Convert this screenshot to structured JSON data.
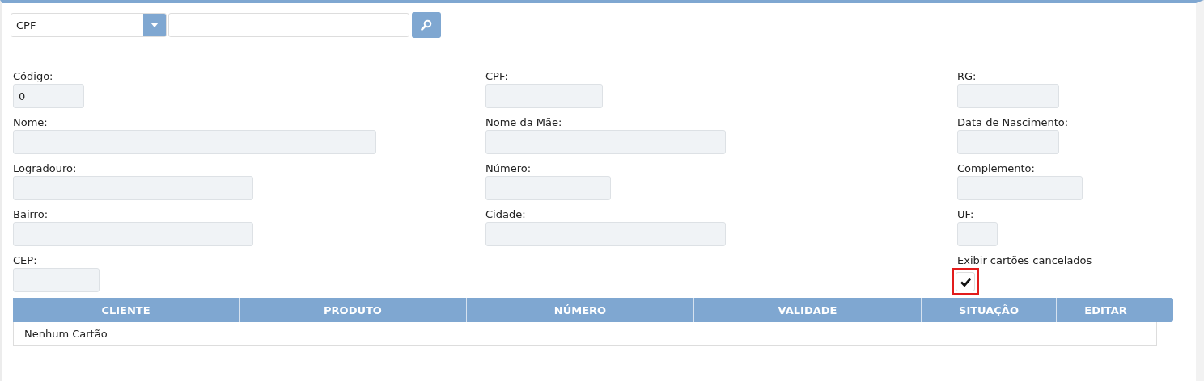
{
  "search": {
    "type_select": {
      "value": "CPF"
    }
  },
  "fields": [
    {
      "label": "Código:",
      "value": "0"
    },
    {
      "label": "CPF:"
    },
    {
      "label": "RG:"
    },
    {
      "label": "Nome:"
    },
    {
      "label": "Nome da Mãe:"
    },
    {
      "label": "Data de Nascimento:"
    },
    {
      "label": "Logradouro:"
    },
    {
      "label": "Número:"
    },
    {
      "label": "Complemento:"
    },
    {
      "label": "Bairro:"
    },
    {
      "label": "Cidade:"
    },
    {
      "label": "UF:"
    },
    {
      "label": "CEP:"
    }
  ],
  "show_cancelled": {
    "label": "Exibir cartões cancelados",
    "checked": true,
    "highlighted": true
  },
  "table": {
    "columns": [
      "CLIENTE",
      "PRODUTO",
      "NÚMERO",
      "VALIDADE",
      "SITUAÇÃO",
      "EDITAR"
    ],
    "empty_message": "Nenhum Cartão"
  }
}
